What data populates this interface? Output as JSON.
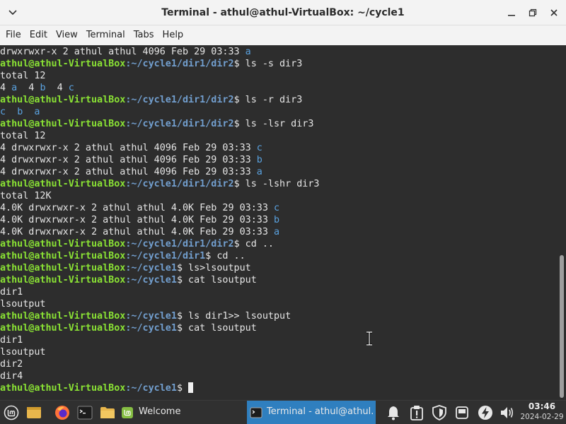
{
  "window": {
    "title": "Terminal - athul@athul-VirtualBox: ~/cycle1"
  },
  "menubar": {
    "items": [
      "File",
      "Edit",
      "View",
      "Terminal",
      "Tabs",
      "Help"
    ]
  },
  "terminal": {
    "user": "athul@athul-VirtualBox",
    "lines": {
      "l0": {
        "t1": "drwxrwxr-x 2 athul athul 4096 Feb 29 03:33 ",
        "d1": "a"
      },
      "l1": {
        "u": "athul@athul-VirtualBox",
        "p": ":~/cycle1/dir1/dir2",
        "c": "$ ls -s dir3"
      },
      "l2": {
        "t1": "total 12"
      },
      "l3": {
        "t1": "4 ",
        "d1": "a",
        "t2": "  4 ",
        "d2": "b",
        "t3": "  4 ",
        "d3": "c"
      },
      "l4": {
        "u": "athul@athul-VirtualBox",
        "p": ":~/cycle1/dir1/dir2",
        "c": "$ ls -r dir3"
      },
      "l5": {
        "d1": "c",
        "t1": "  ",
        "d2": "b",
        "t2": "  ",
        "d3": "a"
      },
      "l6": {
        "u": "athul@athul-VirtualBox",
        "p": ":~/cycle1/dir1/dir2",
        "c": "$ ls -lsr dir3"
      },
      "l7": {
        "t1": "total 12"
      },
      "l8": {
        "t1": "4 drwxrwxr-x 2 athul athul 4096 Feb 29 03:33 ",
        "d1": "c"
      },
      "l9": {
        "t1": "4 drwxrwxr-x 2 athul athul 4096 Feb 29 03:33 ",
        "d1": "b"
      },
      "l10": {
        "t1": "4 drwxrwxr-x 2 athul athul 4096 Feb 29 03:33 ",
        "d1": "a"
      },
      "l11": {
        "u": "athul@athul-VirtualBox",
        "p": ":~/cycle1/dir1/dir2",
        "c": "$ ls -lshr dir3"
      },
      "l12": {
        "t1": "total 12K"
      },
      "l13": {
        "t1": "4.0K drwxrwxr-x 2 athul athul 4.0K Feb 29 03:33 ",
        "d1": "c"
      },
      "l14": {
        "t1": "4.0K drwxrwxr-x 2 athul athul 4.0K Feb 29 03:33 ",
        "d1": "b"
      },
      "l15": {
        "t1": "4.0K drwxrwxr-x 2 athul athul 4.0K Feb 29 03:33 ",
        "d1": "a"
      },
      "l16": {
        "u": "athul@athul-VirtualBox",
        "p": ":~/cycle1/dir1/dir2",
        "c": "$ cd .."
      },
      "l17": {
        "u": "athul@athul-VirtualBox",
        "p": ":~/cycle1/dir1",
        "c": "$ cd .."
      },
      "l18": {
        "u": "athul@athul-VirtualBox",
        "p": ":~/cycle1",
        "c": "$ ls>lsoutput"
      },
      "l19": {
        "u": "athul@athul-VirtualBox",
        "p": ":~/cycle1",
        "c": "$ cat lsoutput"
      },
      "l20": {
        "t1": "dir1"
      },
      "l21": {
        "t1": "lsoutput"
      },
      "l22": {
        "u": "athul@athul-VirtualBox",
        "p": ":~/cycle1",
        "c": "$ ls dir1>> lsoutput"
      },
      "l23": {
        "u": "athul@athul-VirtualBox",
        "p": ":~/cycle1",
        "c": "$ cat lsoutput"
      },
      "l24": {
        "t1": "dir1"
      },
      "l25": {
        "t1": "lsoutput"
      },
      "l26": {
        "t1": "dir2"
      },
      "l27": {
        "t1": "dir4"
      },
      "l28": {
        "u": "athul@athul-VirtualBox",
        "p": ":~/cycle1",
        "c": "$ "
      }
    }
  },
  "taskbar": {
    "welcome_label": "Welcome",
    "terminal_label": "Terminal - athul@athul...",
    "icons": [
      "mint-menu-icon",
      "show-desktop-icon",
      "firefox-icon",
      "terminal-icon",
      "files-icon",
      "welcome-icon",
      "notifications-icon",
      "update-manager-icon",
      "shield-icon",
      "removable-drive-icon",
      "network-icon",
      "volume-icon"
    ]
  },
  "clock": {
    "time": "03:46",
    "date": "2024-02-29"
  },
  "colors": {
    "terminal_bg": "#2d2d2d",
    "user_host": "#8ae234",
    "path": "#729fcf",
    "dir_entry": "#5aa2e0",
    "taskbar_active": "#2f7fbf"
  }
}
